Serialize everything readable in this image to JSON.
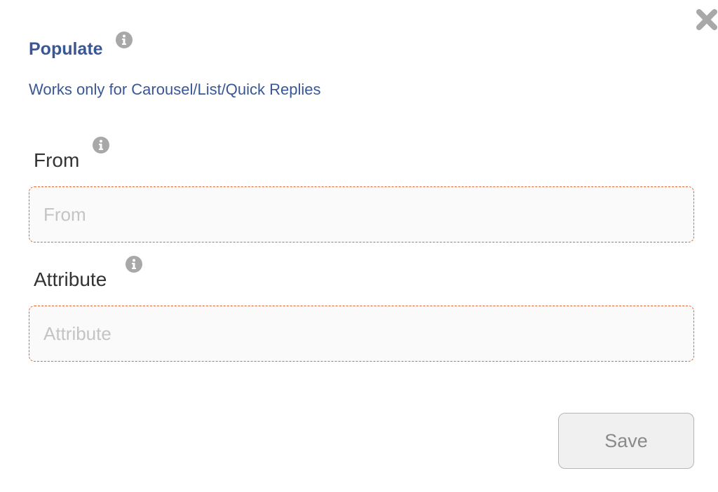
{
  "dialog": {
    "title": "Populate",
    "subtitle": "Works only for Carousel/List/Quick Replies"
  },
  "fields": {
    "from": {
      "label": "From",
      "placeholder": "From",
      "value": ""
    },
    "attribute": {
      "label": "Attribute",
      "placeholder": "Attribute",
      "value": ""
    }
  },
  "actions": {
    "save_label": "Save"
  },
  "icons": {
    "close": "close-icon",
    "info": "info-icon"
  },
  "colors": {
    "title": "#3a5795",
    "input_border": "#e0653a",
    "icon": "#a8a8a8",
    "save_text": "#8a8a8a"
  }
}
